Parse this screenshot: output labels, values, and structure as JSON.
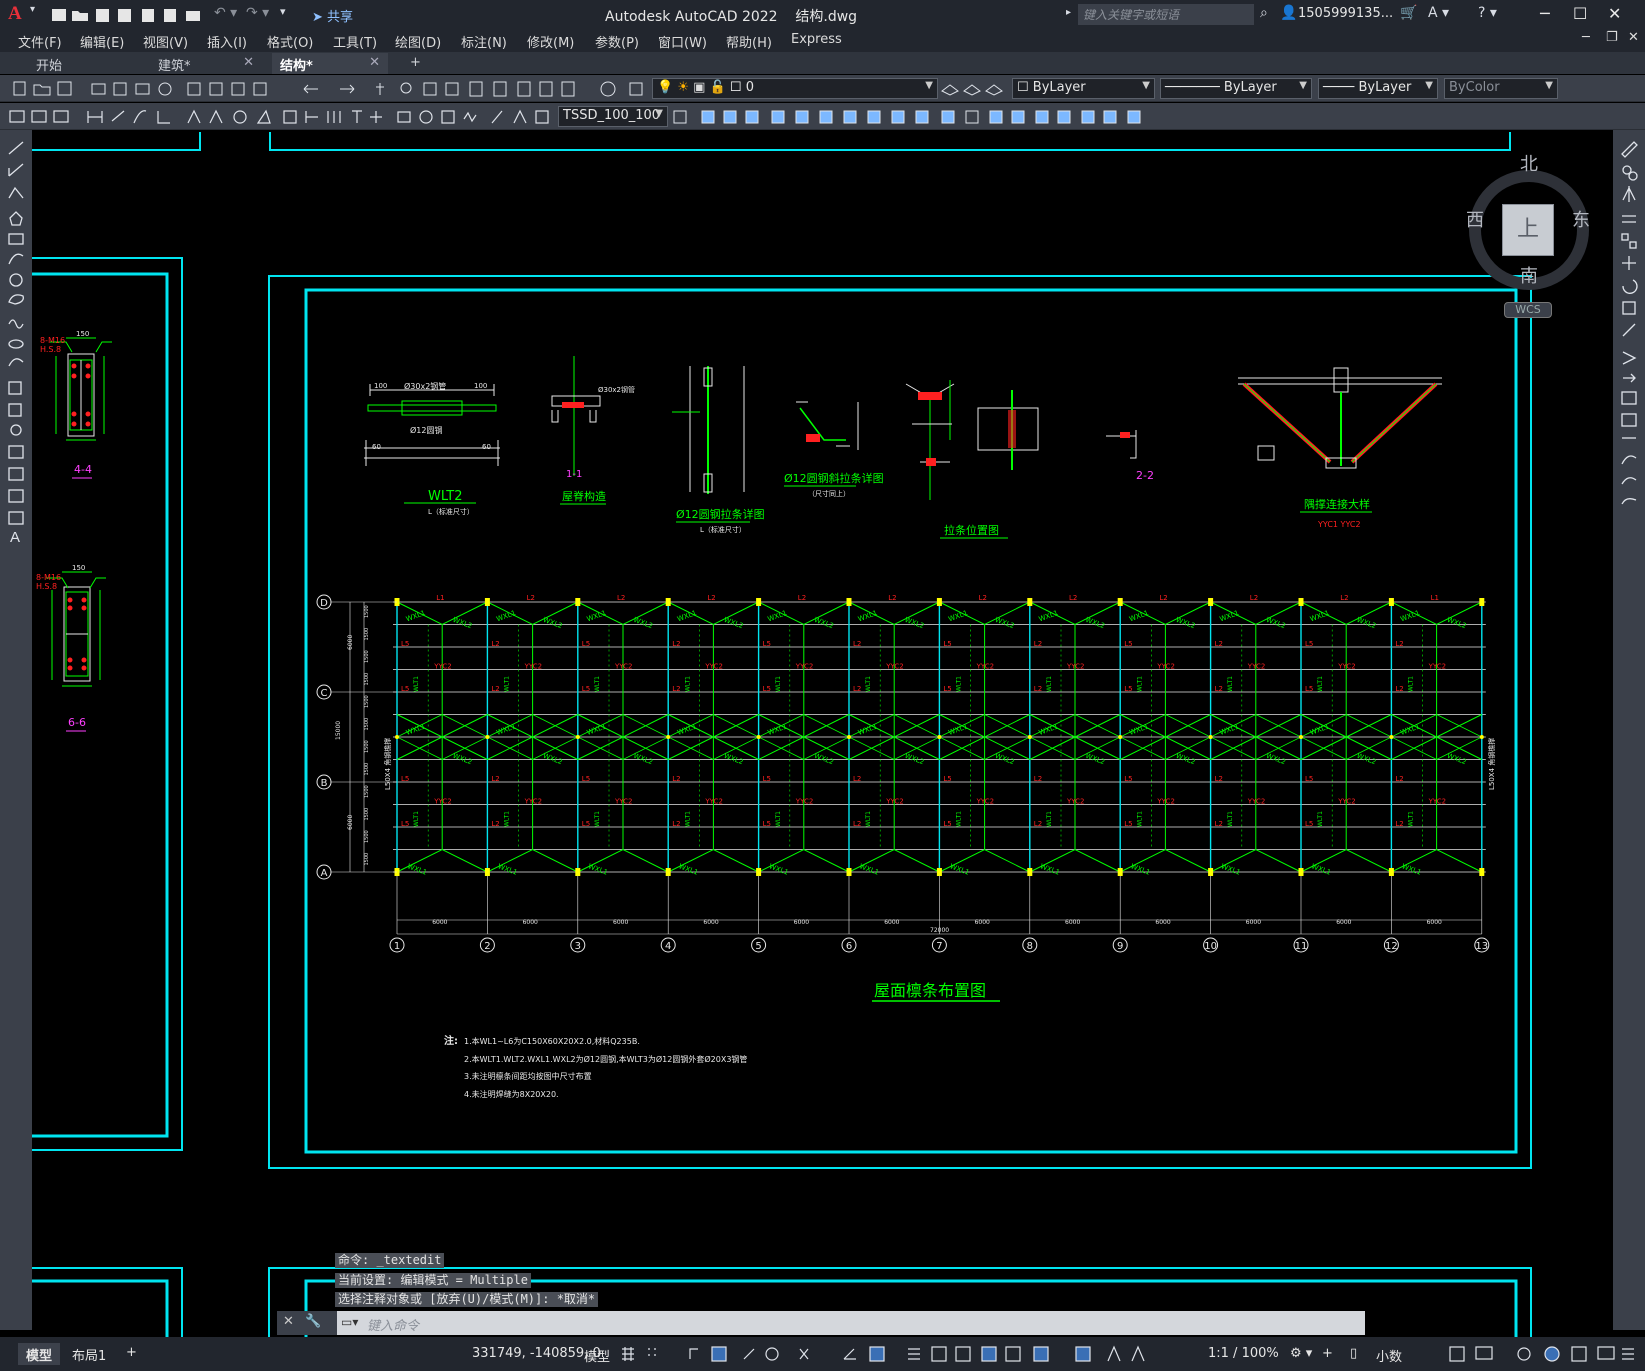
{
  "titlebar": {
    "app_title": "Autodesk AutoCAD 2022",
    "filename": "结构.dwg",
    "share": "共享",
    "search_placeholder": "键入关键字或短语",
    "user": "1505999135...",
    "logo": "A"
  },
  "menu": [
    "文件(F)",
    "编辑(E)",
    "视图(V)",
    "插入(I)",
    "格式(O)",
    "工具(T)",
    "绘图(D)",
    "标注(N)",
    "修改(M)",
    "参数(P)",
    "窗口(W)",
    "帮助(H)",
    "Express"
  ],
  "tabs": [
    {
      "label": "开始",
      "active": false
    },
    {
      "label": "建筑*",
      "active": false
    },
    {
      "label": "结构*",
      "active": true
    }
  ],
  "toolbar": {
    "layer": "0",
    "color": "ByLayer",
    "linetype": "ByLayer",
    "lineweight": "ByLayer",
    "plotstyle": "ByColor",
    "dimstyle": "TSSD_100_100"
  },
  "viewcube": {
    "north": "北",
    "south": "南",
    "east": "东",
    "west": "西",
    "top": "上",
    "wcs": "WCS"
  },
  "drawing": {
    "main_title": "屋面檩条布置图",
    "details": {
      "wlt2": "WLT2",
      "wlt2_sub": "L（标准尺寸）",
      "ridge": "1-1",
      "ridge_sub": "屋脊构造",
      "rod12": "Ø12圆钢拉条详图",
      "rod12_sub": "L（标准尺寸）",
      "rod12b": "Ø12圆钢斜拉条详图",
      "rod12b_sub": "（尺寸同上）",
      "tie_pos": "拉条位置图",
      "s22": "2-2",
      "brace": "隅撑连接大样",
      "brace_sub": "YYC1 YYC2",
      "s44": "4-4",
      "s66": "6-6",
      "dim_30x2": "Ø30x2钢管",
      "dim_12": "Ø12圆钢",
      "dim_100": "100",
      "dim_60": "60",
      "dim_150": "150",
      "bolt": "8-M16",
      "grade": "H.S.8"
    },
    "notes_head": "注:",
    "notes": [
      "1.本WL1~L6为C150X60X20X2.0,材料Q235B.",
      "2.本WLT1.WLT2.WXL1.WXL2为Ø12圆钢,本WLT3为Ø12圆钢外套Ø20X3钢管",
      "3.未注明檩条间距均按图中尺寸布置",
      "4.未注明焊缝为8X20X20."
    ],
    "axes_x": [
      "1",
      "2",
      "3",
      "4",
      "5",
      "6",
      "7",
      "8",
      "9",
      "10",
      "11",
      "12",
      "13"
    ],
    "axes_y": [
      "D",
      "C",
      "B",
      "A"
    ],
    "span_dim": "6000",
    "total_dim": "72000",
    "side_label": "L50X4 角钢檐撑",
    "y_dims": [
      "1500",
      "6000",
      "15000"
    ],
    "purlin_labels": [
      "L1",
      "L2",
      "L5",
      "L6",
      "L3"
    ],
    "tie_labels": [
      "WLT1",
      "WLT2",
      "WXL1",
      "WXL2"
    ],
    "brace_labels": [
      "YYC1",
      "YYC2"
    ]
  },
  "command": {
    "lines": [
      "命令: _textedit",
      "当前设置: 编辑模式 = Multiple",
      "选择注释对象或 [放弃(U)/模式(M)]: *取消*"
    ],
    "placeholder": "键入命令"
  },
  "status": {
    "model_tab": "模型",
    "layout_tab": "布局1",
    "add_tab": "+",
    "coords": "331749, -140859, 0",
    "mode": "模型",
    "scale": "1:1 / 100%",
    "units": "小数"
  },
  "colors": {
    "cyan": "#00e5f0",
    "green": "#00ff00",
    "red": "#ff2020",
    "yellow": "#ffff00",
    "white": "#e8e8e8",
    "magenta": "#ff40ff"
  }
}
